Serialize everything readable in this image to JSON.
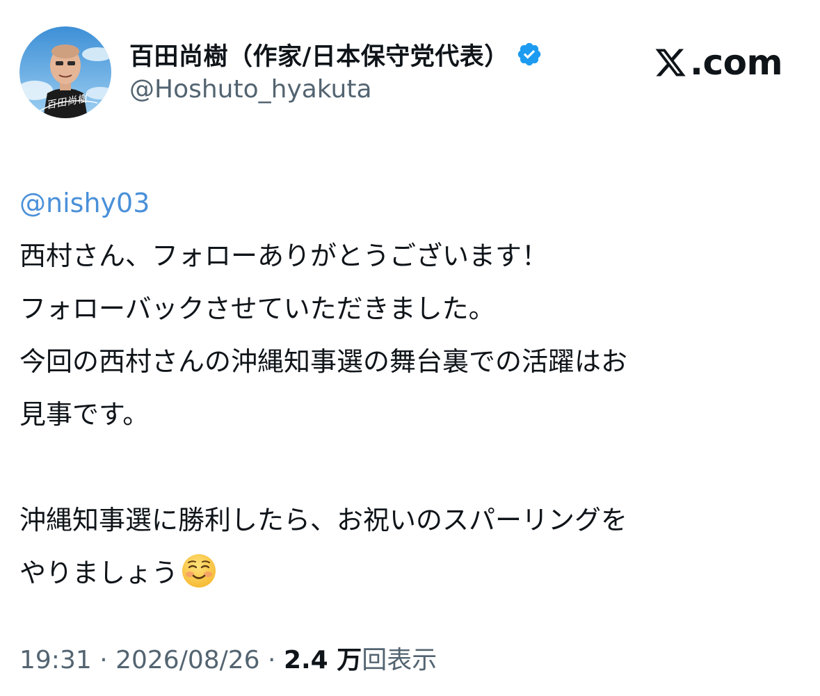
{
  "author": {
    "display_name": "百田尚樹（作家/日本保守党代表）",
    "handle": "@Hoshuto_hyakuta",
    "avatar_signature": "百田尚樹",
    "verified": true,
    "verified_color": "#1d9bf0"
  },
  "site": {
    "logo_icon": "x-logo-icon",
    "domain_suffix": ".com"
  },
  "tweet": {
    "mention": "@nishy03",
    "lines": [
      "西村さん、フォローありがとうございます！",
      "フォローバックさせていただきました。",
      "今回の西村さんの沖縄知事選の舞台裏での活躍はお",
      "見事です。",
      "",
      "沖縄知事選に勝利したら、お祝いのスパーリングを",
      "やりましょう"
    ],
    "trailing_emoji": "smiling-face-icon"
  },
  "meta": {
    "time": "19:31",
    "separator": " · ",
    "date": "2026/08/26",
    "views_count": "2.4 万",
    "views_label": "回表示"
  },
  "colors": {
    "text_primary": "#0f1419",
    "text_secondary": "#536471",
    "mention": "#4a90d9",
    "verified": "#1d9bf0"
  }
}
